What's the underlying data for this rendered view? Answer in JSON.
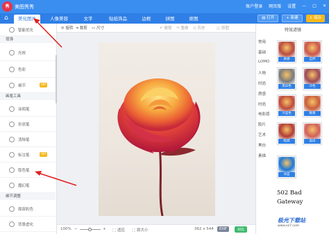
{
  "titlebar": {
    "app_title": "美图秀秀",
    "logo_text": "秀",
    "account": "账户登录",
    "web_edition": "网页版",
    "settings": "设置"
  },
  "menubar": {
    "tabs": [
      "美化图片",
      "人像美容",
      "文字",
      "贴纸饰品",
      "边框",
      "拼图",
      "抠图"
    ],
    "active_tab": "美化图片",
    "open": "打开",
    "new": "新建",
    "save": "保存"
  },
  "toolbar": {
    "rotate": "旋转",
    "crop": "裁剪",
    "size": "尺寸",
    "undo": "撤销",
    "redo": "重做",
    "history": "历史",
    "original": "原图"
  },
  "leftpanel": {
    "smart_optimize": "智能优化",
    "section_enhance": "增强",
    "light": "光效",
    "color": "色彩",
    "detail": "细节",
    "section_brush": "画笔工具",
    "doodle": "涂鸦笔",
    "shape": "形状笔",
    "eraser": "消除笔",
    "marker": "标注笔",
    "color_picker": "取色笔",
    "back_pen": "魔幻笔",
    "section_adjust": "细节调整",
    "partial_color": "局部彩色",
    "bg_blur": "背景虚化",
    "vip": "VIP"
  },
  "statusbar": {
    "zoom": "100%",
    "zoom_minus": "−",
    "zoom_plus": "+",
    "fit": "适应",
    "actual": "原大小",
    "dimensions": "362 x 544",
    "exif": "EXIF",
    "compare": "对比"
  },
  "rightpanel": {
    "title": "特效滤镜",
    "categories": [
      "常用",
      "基础",
      "LOMO",
      "人物",
      "时尚",
      "质感",
      "时尚",
      "电影感",
      "胶片",
      "艺术",
      "黑白",
      "素描"
    ],
    "filters": [
      {
        "label": "质感",
        "color": "#b94a3d"
      },
      {
        "label": "自然",
        "color": "#c9554a"
      },
      {
        "label": "黑白色",
        "color": "#7b7b7b"
      },
      {
        "label": "冷色",
        "color": "#9c4a55"
      },
      {
        "label": "冷蓝色",
        "color": "#bd4a3a"
      },
      {
        "label": "暖黄",
        "color": "#c95c3a"
      },
      {
        "label": "暗调",
        "color": "#b13c33"
      },
      {
        "label": "美白",
        "color": "#d1605a"
      },
      {
        "label": "甜蜜红色",
        "color": "#c04535"
      },
      {
        "label": "全彩",
        "color": "#d05848"
      },
      {
        "label": "冰蓝",
        "color": "#1e78d4"
      }
    ]
  },
  "error_text_line1": "502 Bad",
  "error_text_line2": "Gateway",
  "watermark": {
    "main": "极光下载站",
    "sub": "www.xz7.com"
  }
}
